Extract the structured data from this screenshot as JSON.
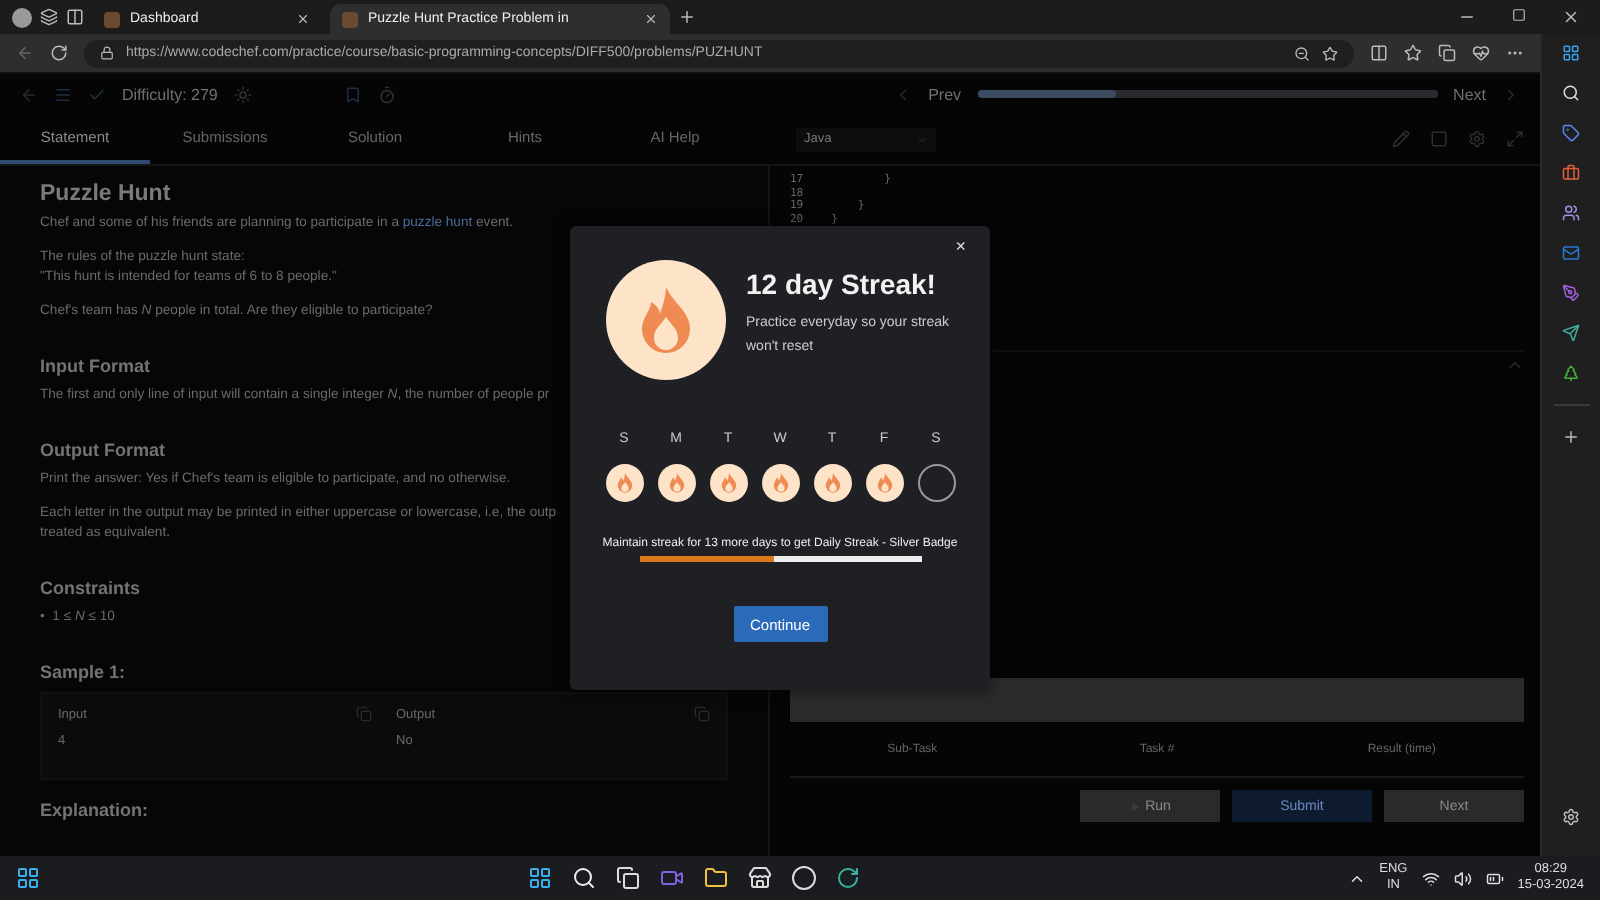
{
  "browser": {
    "tabs": [
      {
        "title": "Dashboard",
        "selected": false
      },
      {
        "title": "Puzzle Hunt Practice Problem in",
        "selected": true
      }
    ],
    "url": "https://www.codechef.com/practice/course/basic-programming-concepts/DIFF500/problems/PUZHUNT"
  },
  "problem_bar": {
    "difficulty": "Difficulty: 279",
    "prev": "Prev",
    "next": "Next",
    "level": 0.3
  },
  "panel_tabs": [
    {
      "label": "Statement",
      "selected": true
    },
    {
      "label": "Submissions",
      "selected": false
    },
    {
      "label": "Solution",
      "selected": false
    },
    {
      "label": "Hints",
      "selected": false
    },
    {
      "label": "AI Help",
      "selected": false
    }
  ],
  "statement": [
    {
      "kind": "title",
      "text": "Puzzle Hunt"
    },
    {
      "kind": "link_para",
      "before": "Chef and some of his friends are planning to participate in a ",
      "link": "puzzle hunt",
      "after": " event."
    },
    {
      "kind": "para",
      "lines": [
        "The rules of the puzzle hunt state:",
        "\"This hunt is intended for teams of 6 to 8 people.\""
      ]
    },
    {
      "kind": "para",
      "lines": [
        "Chef's team has *N* people in total. Are they eligible to participate?"
      ]
    },
    {
      "kind": "heading",
      "text": "Input Format"
    },
    {
      "kind": "para",
      "lines": [
        "The first and only line of input will contain a single integer *N*, the number of people pr"
      ]
    },
    {
      "kind": "heading",
      "text": "Output Format"
    },
    {
      "kind": "para",
      "lines": [
        "Print the answer: Yes if Chef's team is eligible to participate, and no otherwise."
      ]
    },
    {
      "kind": "para",
      "lines": [
        "Each letter in the output may be printed in either uppercase or lowercase, i.e, the outp",
        "treated as equivalent."
      ]
    },
    {
      "kind": "heading",
      "text": "Constraints"
    },
    {
      "kind": "bullet",
      "text": "•  1 ≤ *N* ≤ 10"
    },
    {
      "kind": "heading",
      "text": "Sample 1:"
    },
    {
      "kind": "sample",
      "input_label": "Input",
      "input": "4",
      "output_label": "Output",
      "output": "No"
    },
    {
      "kind": "heading",
      "text": "Explanation:"
    }
  ],
  "editor": {
    "language": "Java",
    "lines": [
      {
        "number": "17",
        "code": "        }"
      },
      {
        "number": "18"
      },
      {
        "number": "19",
        "code": "    }"
      },
      {
        "number": "20",
        "code": "}"
      }
    ],
    "columns": [
      "Sub-Task",
      "Task #",
      "Result (time)"
    ],
    "buttons": [
      {
        "kind": "run",
        "label": "Run"
      },
      {
        "kind": "submit",
        "label": "Submit"
      },
      {
        "kind": "next",
        "label": "Next"
      }
    ]
  },
  "modal": {
    "close": "×",
    "title": "12 day Streak!",
    "subtitle": "Practice everyday so your streak won't reset",
    "days": [
      {
        "label": "S",
        "done": true
      },
      {
        "label": "M",
        "done": true
      },
      {
        "label": "T",
        "done": true
      },
      {
        "label": "W",
        "done": true
      },
      {
        "label": "T",
        "done": true
      },
      {
        "label": "F",
        "done": true
      },
      {
        "label": "S",
        "done": false
      }
    ],
    "goal": "Maintain streak for 13 more days to get Daily Streak - Silver Badge",
    "level": 0.48,
    "button": "Continue"
  },
  "taskbar": {
    "language": "ENG",
    "region": "IN",
    "time": "08:29",
    "date": "15-03-2024"
  }
}
